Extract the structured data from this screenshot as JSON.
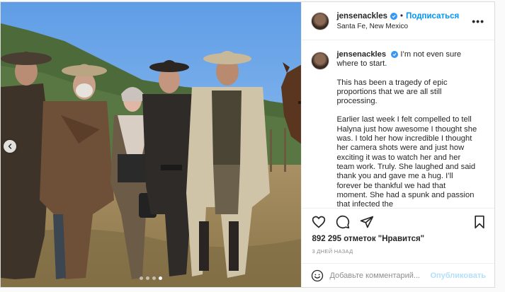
{
  "header": {
    "username": "jensenackles",
    "separator": "•",
    "follow_label": "Подписаться",
    "location": "Santa Fe, New Mexico",
    "more_icon": "more-horizontal-icon"
  },
  "caption": {
    "username": "jensenackles",
    "first_line": "I’m not even sure where to start.",
    "paragraphs": [
      "This has been a tragedy of epic proportions that we are all still processing.",
      "Earlier last week I felt compelled to tell Halyna just how awesome I thought she was. I told her how incredible I thought her camera shots were and just how exciting it was to watch her and her team work. Truly. She laughed and said thank you and gave me a hug. I’ll forever be thankful we had that moment.  She had a spunk and passion that infected the"
    ]
  },
  "photo": {
    "slides": 4,
    "active_slide": 4,
    "colors": {
      "sky": "#7fb2e8",
      "hills": "#4d6b3a",
      "grass": "#b39a6a"
    }
  },
  "actions": {
    "like_icon": "heart-icon",
    "comment_icon": "comment-icon",
    "share_icon": "send-icon",
    "save_icon": "bookmark-icon"
  },
  "likes_text": "892 295 отметок \"Нравится\"",
  "time_ago": "3 ДНЕЙ НАЗАД",
  "comment": {
    "placeholder": "Добавьте комментарий...",
    "publish_label": "Опубликовать"
  },
  "colors": {
    "accent": "#0095f6",
    "verified": "#3897f0",
    "publish_disabled": "#b2dffc"
  }
}
